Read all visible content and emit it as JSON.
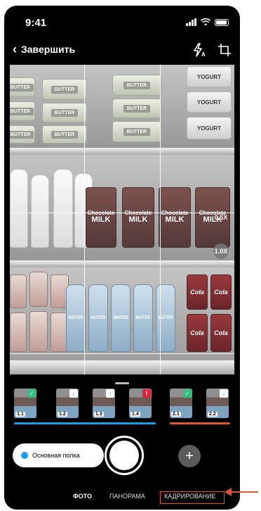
{
  "status_bar": {
    "time": "9:41"
  },
  "nav": {
    "back_label": "Завершить",
    "flash_icon": "flash-auto-icon",
    "crop_icon": "crop-icon"
  },
  "camera": {
    "products": {
      "butter": "BUTTER",
      "yogurt": "YOGURT",
      "chocolate_milk": [
        "Chocolate",
        "MILK"
      ],
      "cola": "Cola",
      "water": "WATER"
    },
    "zoom_options": [
      "0.5X",
      "1.0X"
    ],
    "zoom_selected": "1.0X"
  },
  "thumbnails": [
    {
      "label": "1.1",
      "badge": "check",
      "badge_color": "#2ec27e"
    },
    {
      "label": "1.2",
      "badge": "arrow-down",
      "badge_color": "#18a0e6"
    },
    {
      "label": "1.3",
      "badge": "arrow-up",
      "badge_color": "#2ec27e"
    },
    {
      "label": "1.4",
      "badge": "!",
      "badge_color": "#e0203c"
    },
    {
      "label": "2.1",
      "badge": "check",
      "badge_color": "#2ec27e"
    },
    {
      "label": "2.2",
      "badge": "arrow-down",
      "badge_color": "#18a0e6"
    }
  ],
  "groups": [
    {
      "thumbs": [
        "1.1",
        "1.2",
        "1.3",
        "1.4"
      ],
      "color": "#18a0e6"
    },
    {
      "thumbs": [
        "2.1",
        "2.2"
      ],
      "color": "#e35336"
    }
  ],
  "controls": {
    "shelf_chip_label": "Основная полка",
    "add_label": "+"
  },
  "modes": {
    "photo": "ФОТО",
    "panorama": "ПАНОРАМА",
    "crop": "КАДРИРОВАНИЕ",
    "active": "ФОТО",
    "highlighted": "КАДРИРОВАНИЕ"
  },
  "colors": {
    "accent_blue": "#18a0e6",
    "accent_orange": "#e35336",
    "success_green": "#2ec27e",
    "error_red": "#e0203c"
  }
}
